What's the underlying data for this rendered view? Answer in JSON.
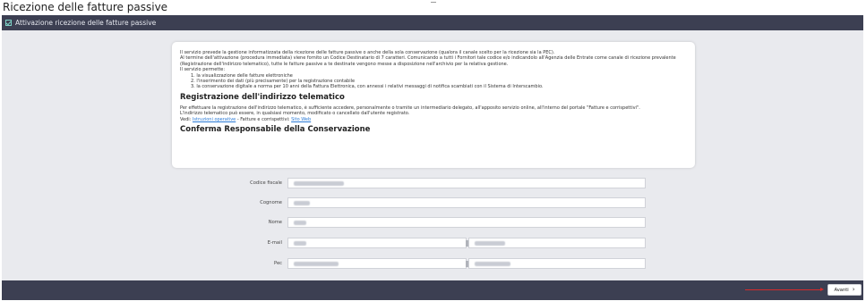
{
  "page": {
    "title": "Ricezione delle fatture passive"
  },
  "section": {
    "label": "Attivazione ricezione delle fatture passive"
  },
  "info": {
    "p1": "Il servizio prevede la gestione informatizzata della ricezione delle fatture passive o anche della sola conservazione (qualora il canale scelto per la ricezione sia la PEC).",
    "p2": "Al termine dell'attivazione (procedura immediata) viene fornito un Codice Destinatario di 7 caratteri. Comunicando a tutti i Fornitori tale codice e/o indicandolo all'Agenzia delle Entrate come canale di ricezione prevalente (Registrazione dell'indirizzo telematico), tutte le fatture passive a te destinate vengono messe a disposizione nell'archivio per la relativa gestione.",
    "p3": "Il servizio permette:",
    "list": [
      "1. la visualizzazione delle fatture elettroniche",
      "2. l'inserimento dei dati (più precisamente) per la registrazione contabile",
      "3. la conservazione digitale a norma per 10 anni della Fattura Elettronica, con annessi i relativi messaggi di notifica scambiati con il Sistema di Interscambio."
    ],
    "heading1": "Registrazione dell'indirizzo telematico",
    "p4": "Per effettuare la registrazione dell'indirizzo telematico, è sufficiente accedere, personalmente o tramite un intermediario delegato, all'apposito servizio online, all'interno del portale \"Fatture e corrispettivi\".",
    "p5": "L'indirizzo telematico può essere, in qualsiasi momento, modificato o cancellato dall'utente registrato.",
    "vedi_prefix": "Vedi: ",
    "link1": "Istruzioni operative",
    "vedi_mid": " - Fatture e corrispettivi: ",
    "link2": "Sito Web",
    "heading2": "Conferma Responsabile della Conservazione"
  },
  "form": {
    "codice_fiscale_label": "Codice fiscale",
    "cognome_label": "Cognome",
    "nome_label": "Nome",
    "email_label": "E-mail",
    "pec_label": "Pec"
  },
  "footer": {
    "next_label": "Avanti",
    "next_icon": "chevron-right-icon"
  },
  "colors": {
    "bar": "#3c3f52",
    "background": "#e9eaee",
    "arrow": "#d62b2b"
  }
}
